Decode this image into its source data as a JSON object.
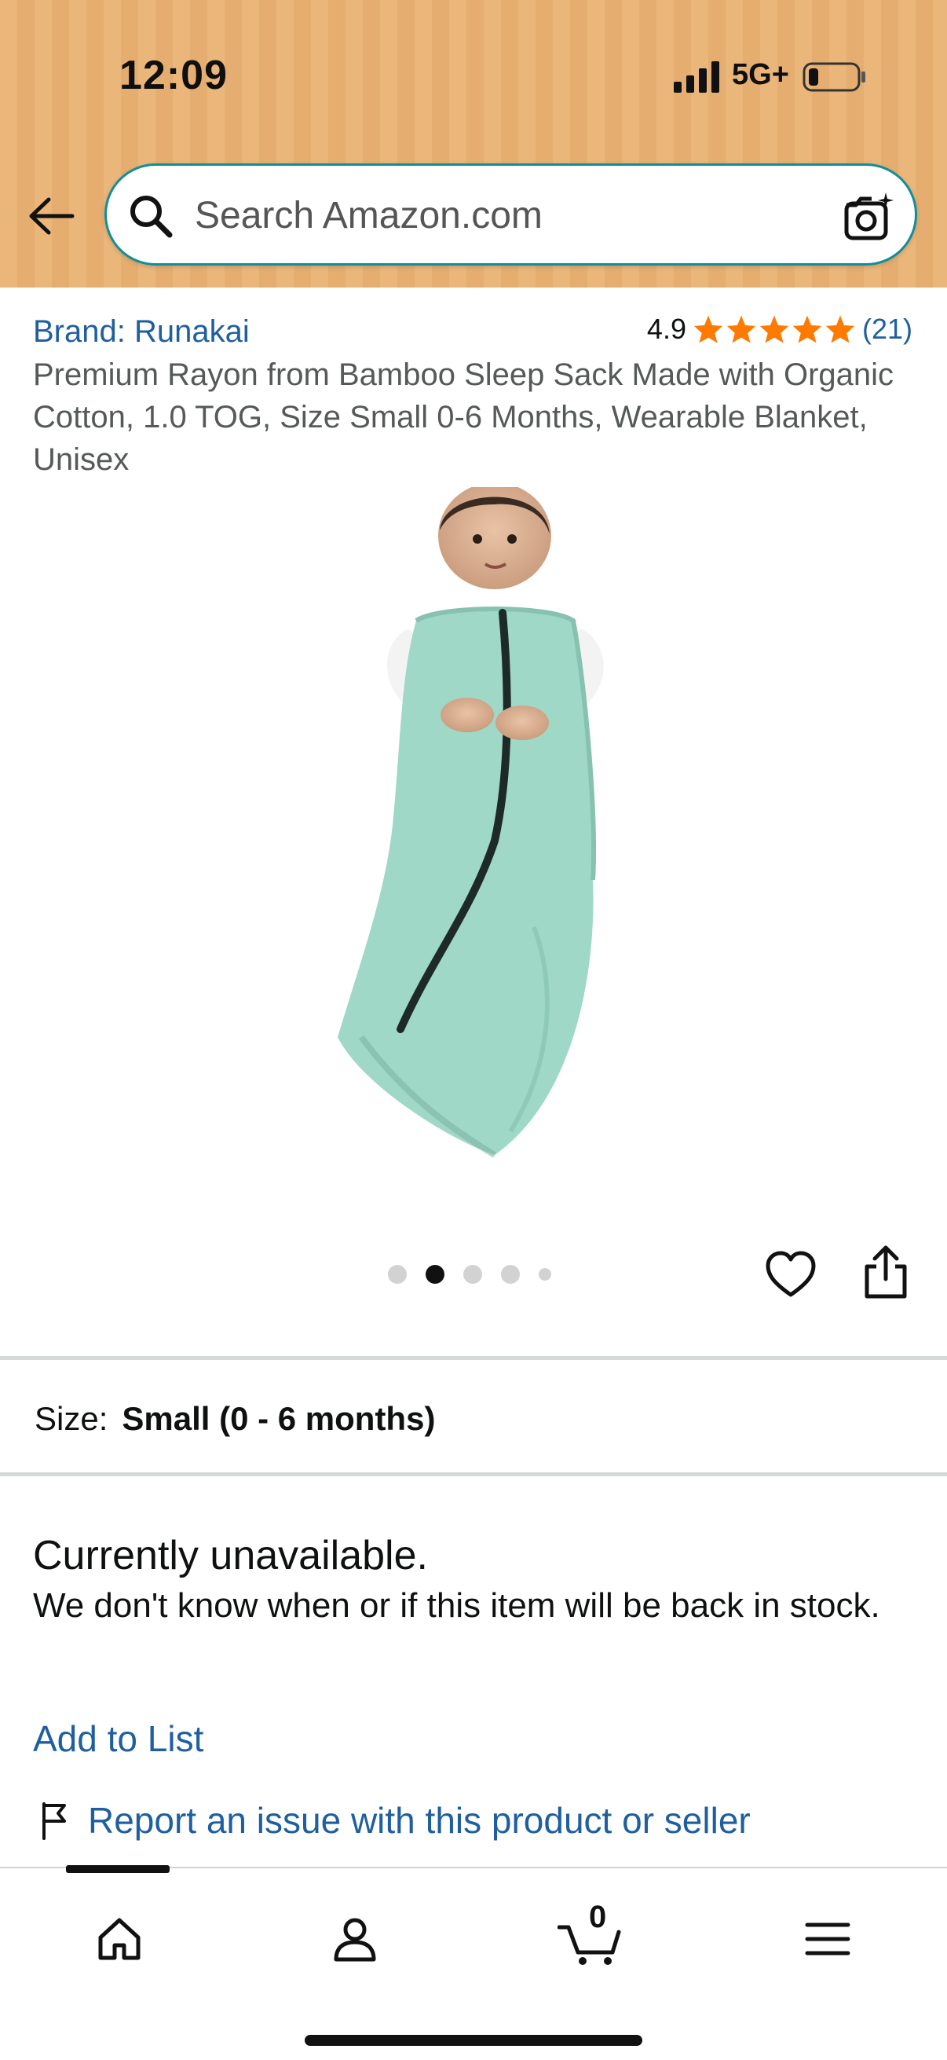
{
  "status_bar": {
    "time": "12:09",
    "network": "5G+"
  },
  "search": {
    "placeholder": "Search Amazon.com"
  },
  "product": {
    "brand": "Brand: Runakai",
    "rating_value": "4.9",
    "rating_count": "(21)",
    "stars": 5,
    "title": "Premium Rayon from Bamboo Sleep Sack Made with Organic Cotton, 1.0 TOG, Size Small 0-6 Months, Wearable Blanket, Unisex",
    "image_count": 5,
    "active_image_index": 1
  },
  "size": {
    "label": "Size:",
    "value": "Small (0 - 6 months)"
  },
  "availability": {
    "status": "Currently unavailable.",
    "description": "We don't know when or if this item will be back in stock."
  },
  "actions": {
    "add_to_list": "Add to List",
    "report": "Report an issue with this product or seller"
  },
  "bottom_nav": {
    "cart_count": "0",
    "items": [
      "home-icon",
      "account-icon",
      "cart-icon",
      "menu-icon"
    ]
  },
  "colors": {
    "header_bg": "#eab67a",
    "link": "#1f5f9f",
    "star": "#ff7a00",
    "product_fabric": "#9fd8c6"
  }
}
